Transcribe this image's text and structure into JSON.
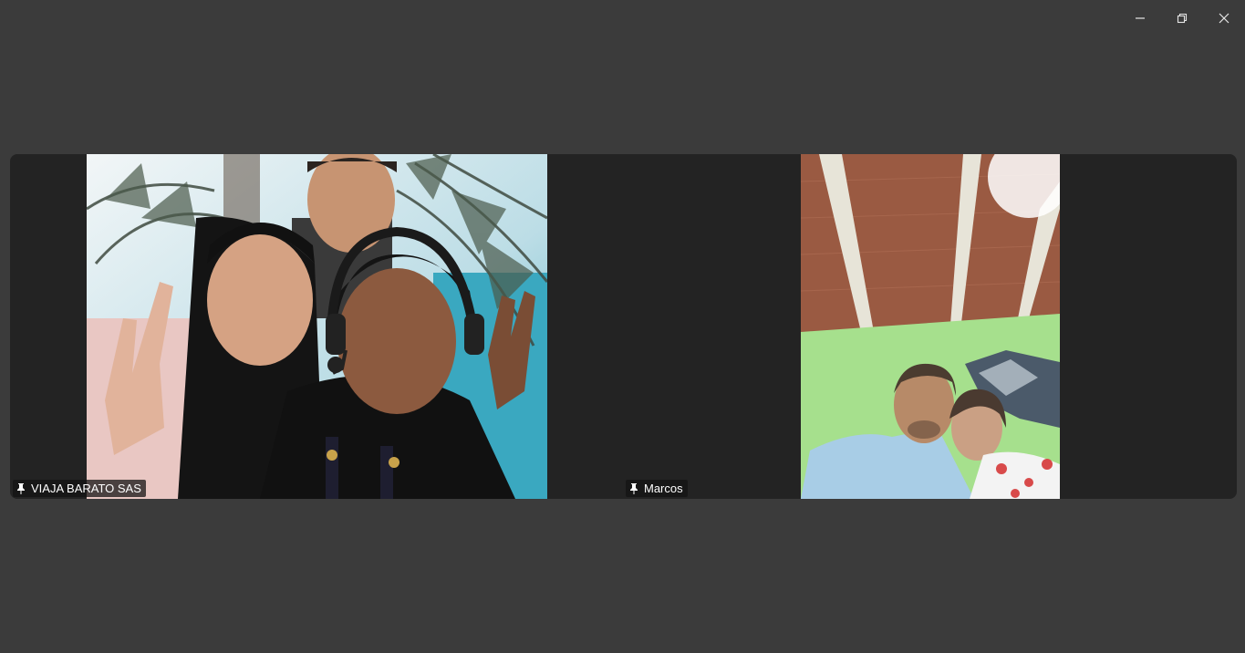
{
  "window": {
    "controls": {
      "minimize_icon": "minimize-icon",
      "restore_icon": "restore-icon",
      "close_icon": "close-icon"
    }
  },
  "gallery": {
    "participants": [
      {
        "name": "VIAJA BARATO SAS",
        "pinned": true,
        "pin_icon": "pin-icon",
        "video": "selfie of three people and a man behind them in front of a palm tree backdrop"
      },
      {
        "name": "Marcos",
        "pinned": true,
        "pin_icon": "pin-icon",
        "video": "a man and a woman under a wooden ceiling with green walls"
      }
    ]
  },
  "colors": {
    "background": "#3b3b3b",
    "strip": "#232323",
    "name_tag_bg": "#141414",
    "text": "#ffffff"
  }
}
